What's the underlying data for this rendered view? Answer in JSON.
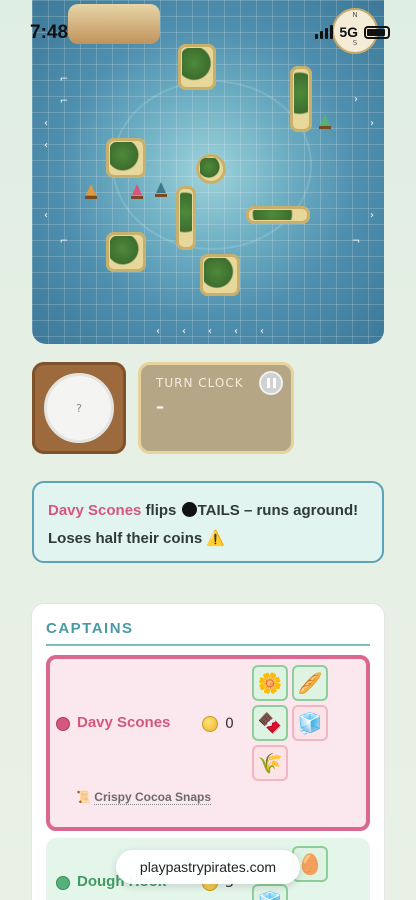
{
  "status": {
    "time": "7:48",
    "network": "5G"
  },
  "board": {
    "compass_letters": [
      "N",
      "S"
    ]
  },
  "coin": {
    "face": "?"
  },
  "turn_clock": {
    "label": "TURN CLOCK",
    "value": "–"
  },
  "banner": {
    "captain": "Davy Scones",
    "text_before": " flips ",
    "result": "TAILS",
    "text_after": " – runs aground! Loses half their coins ",
    "warn": "⚠️"
  },
  "captains": {
    "title": "CAPTAINS",
    "list": [
      {
        "name": "Davy Scones",
        "color": "#d6577d",
        "coins": "0",
        "recipe_icon": "📜",
        "recipe": "Crispy Cocoa Snaps",
        "ingredients": [
          "🌼",
          "🥖",
          "🍫",
          "🧊",
          "🌾"
        ]
      },
      {
        "name": "Dough Hook",
        "color": "#56b07a",
        "coins": "3",
        "ingredients": [
          "🥚",
          "🧊"
        ]
      }
    ]
  },
  "browser": {
    "url": "playpastrypirates.com"
  }
}
